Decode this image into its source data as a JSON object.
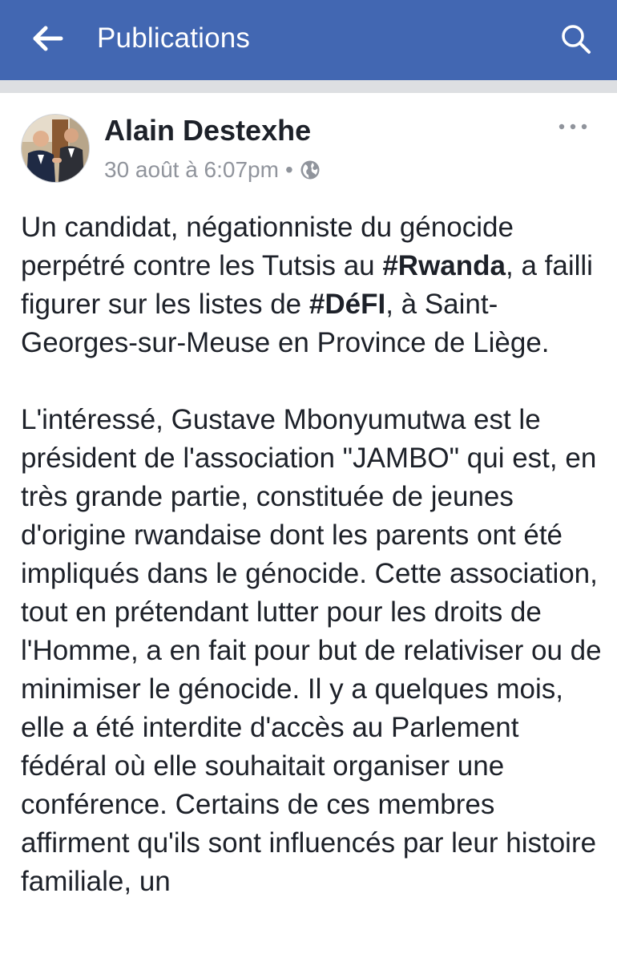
{
  "appbar": {
    "title": "Publications",
    "back_icon": "arrow-left-icon",
    "search_icon": "search-icon",
    "color": "#4267b2"
  },
  "post": {
    "author": "Alain Destexhe",
    "timestamp": "30 août à 6:07pm",
    "separator": "•",
    "privacy_icon": "globe-icon",
    "more_icon": "more-horizontal-icon",
    "paragraph1": {
      "t1": "Un candidat, négationniste du génocide perpétré contre les Tutsis au ",
      "tag1": "#Rwanda",
      "t2": ", a failli figurer sur les listes de ",
      "tag2": "#DéFI",
      "t3": ", à Saint-Georges-sur-Meuse en Province de Liège."
    },
    "paragraph2": "L'intéressé, Gustave Mbonyumutwa est le président de l'association \"JAMBO\" qui est, en très grande partie, constituée de jeunes d'origine rwandaise dont les parents ont été impliqués dans le génocide. Cette association, tout en prétendant lutter pour les droits de l'Homme, a en fait pour but de relativiser ou de minimiser le génocide. Il y a quelques mois, elle a été interdite d'accès au Parlement fédéral où elle souhaitait organiser une conférence. Certains de ces membres affirment qu'ils sont influencés par leur histoire familiale, un"
  }
}
